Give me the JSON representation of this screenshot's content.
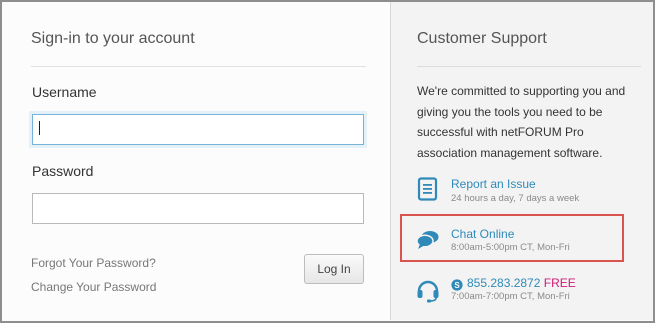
{
  "login": {
    "title": "Sign-in to your account",
    "username_label": "Username",
    "username_value": "",
    "password_label": "Password",
    "password_value": "",
    "forgot_password": "Forgot Your Password?",
    "change_password": "Change Your Password",
    "login_button": "Log In"
  },
  "support": {
    "title": "Customer Support",
    "description": "We're committed to supporting you and giving you the tools you need to be successful with netFORUM Pro association management software.",
    "items": [
      {
        "icon": "document-icon",
        "title": "Report an Issue",
        "subtitle": "24 hours a day, 7 days a week"
      },
      {
        "icon": "chat-bubbles-icon",
        "title": "Chat Online",
        "subtitle": "8:00am-5:00pm CT, Mon-Fri"
      },
      {
        "icon": "headset-icon",
        "phone": "855.283.2872",
        "free": "FREE",
        "subtitle": "7:00am-7:00pm CT, Mon-Fri"
      }
    ]
  },
  "colors": {
    "accent": "#2f8ab9",
    "highlight": "#d9534f",
    "free": "#d2197a"
  }
}
